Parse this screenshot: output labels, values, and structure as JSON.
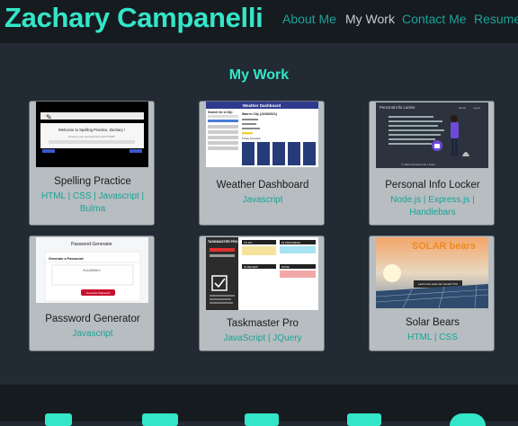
{
  "header": {
    "name": "Zachary Campanelli",
    "nav": [
      "About Me",
      "My Work",
      "Contact Me",
      "Resume"
    ]
  },
  "colors": {
    "accent": "#33e6c8",
    "link": "#1aa398",
    "nav_active": "#c8ccd0",
    "background": "#222a33",
    "card": "#b7bdc0"
  },
  "section_title": "My Work",
  "projects": [
    {
      "title": "Spelling Practice",
      "tech_line1": "HTML | CSS | Javascript |",
      "tech_line2": "Bulma",
      "thumb": {
        "heading": "Welcome to Spelling Practice, Zachary !",
        "subtext": "Choose your word list and click START"
      }
    },
    {
      "title": "Weather Dashboard",
      "tech_line1": "Javascript",
      "tech_line2": "",
      "thumb": {
        "banner": "Weather Dashboard",
        "search_label": "Search for a City:",
        "city": "Warren City (10/30/2021)",
        "forecast_label": "5-Day Forecast:"
      }
    },
    {
      "title": "Personal Info Locker",
      "tech_line1": "Node.js | Express.js |",
      "tech_line2": "Handlebars",
      "thumb": {
        "brand": "Personal Info Locker",
        "menu_1": "Home",
        "menu_2": "Log in",
        "footer": "© 2022 Personal Info Locker"
      }
    },
    {
      "title": "Password Generator",
      "tech_line1": "Javascript",
      "tech_line2": "",
      "thumb": {
        "heading": "Password Generator",
        "subheading": "Generate a Password",
        "password": "Pw4yR#kBiX",
        "button": "Generate Password"
      }
    },
    {
      "title": "Taskmaster Pro",
      "tech_line1": "JavaScript | JQuery",
      "tech_line2": "",
      "thumb": {
        "brand": "TASKMASTER PRO EDITION",
        "col_1": "TO DO",
        "col_2": "IN PROGRESS",
        "col_3": "IN REVIEW",
        "col_4": "DONE"
      }
    },
    {
      "title": "Solar Bears",
      "tech_line1": "HTML | CSS",
      "tech_line2": "",
      "thumb": {
        "logo": "SOLAR bears",
        "cta": "Learn how solar can benefit YOU"
      }
    }
  ]
}
